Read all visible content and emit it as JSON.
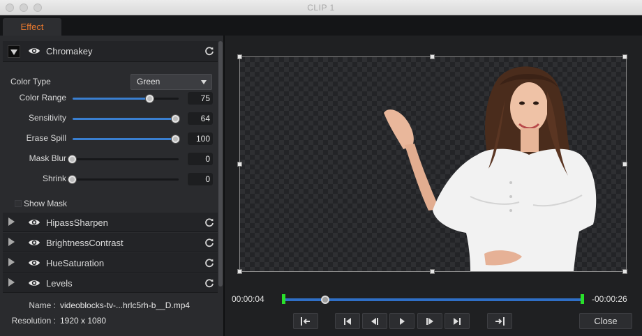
{
  "window": {
    "title": "CLIP 1"
  },
  "tabs": [
    {
      "label": "Effect",
      "active": true
    }
  ],
  "colors": {
    "accent_tab": "#e8782e",
    "slider_fill": "#3a7fd0",
    "timeline_mark": "#29e02b"
  },
  "chromakey": {
    "name": "Chromakey",
    "expanded": true,
    "color_type": {
      "label": "Color Type",
      "value": "Green"
    },
    "sliders": [
      {
        "key": "color_range",
        "label": "Color Range",
        "value": "75",
        "fraction": 0.75
      },
      {
        "key": "sensitivity",
        "label": "Sensitivity",
        "value": "64",
        "fraction": 1.0
      },
      {
        "key": "erase_spill",
        "label": "Erase Spill",
        "value": "100",
        "fraction": 1.0
      },
      {
        "key": "mask_blur",
        "label": "Mask Blur",
        "value": "0",
        "fraction": 0.0
      },
      {
        "key": "shrink",
        "label": "Shrink",
        "value": "0",
        "fraction": 0.0
      }
    ],
    "show_mask": {
      "label": "Show Mask",
      "checked": false
    }
  },
  "effects": [
    {
      "name": "HipassSharpen"
    },
    {
      "name": "BrightnessContrast"
    },
    {
      "name": "HueSaturation"
    },
    {
      "name": "Levels"
    }
  ],
  "file_info": {
    "name_label": "Name :",
    "name_value": "videoblocks-tv-...hrlc5rh-b__D.mp4",
    "resolution_label": "Resolution :",
    "resolution_value": "1920 x 1080"
  },
  "timeline": {
    "current_time": "00:00:04",
    "remaining_time": "-00:00:26",
    "playhead_fraction": 0.14
  },
  "controls": {
    "icons": [
      "mark-in-icon",
      "skip-to-start-icon",
      "step-back-icon",
      "play-icon",
      "step-forward-icon",
      "skip-to-end-icon",
      "mark-out-icon"
    ],
    "close_label": "Close"
  }
}
